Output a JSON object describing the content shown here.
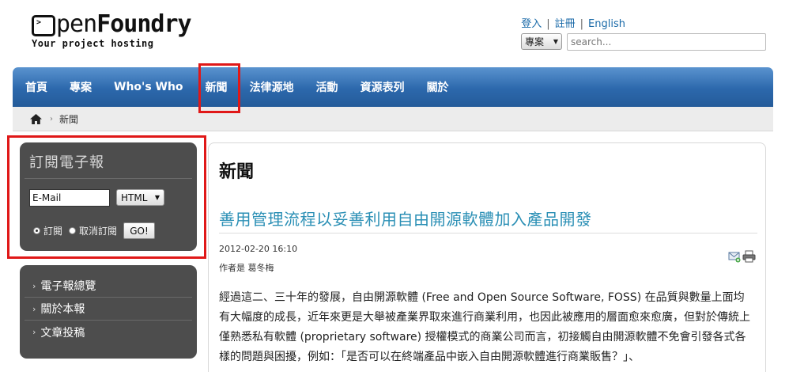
{
  "logo": {
    "prompt": ">",
    "open": "pen",
    "foundry": "Foundry",
    "tagline": "Your project hosting"
  },
  "toplinks": {
    "login": "登入",
    "register": "註冊",
    "english": "English",
    "sep": "|"
  },
  "search": {
    "scope": "專案",
    "placeholder": "search..."
  },
  "nav": [
    "首頁",
    "專案",
    "Who's Who",
    "新聞",
    "法律源地",
    "活動",
    "資源表列",
    "關於"
  ],
  "breadcrumb": {
    "current": "新聞"
  },
  "subscribe": {
    "title": "訂閱電子報",
    "email_value": "E-Mail",
    "format": "HTML",
    "opt_subscribe": "訂閱",
    "opt_unsubscribe": "取消訂閱",
    "go": "GO!"
  },
  "sidelinks": [
    "電子報總覽",
    "關於本報",
    "文章投稿"
  ],
  "main": {
    "page_title": "新聞",
    "article_title": "善用管理流程以妥善利用自由開源軟體加入產品開發",
    "date": "2012-02-20 16:10",
    "author": "作者是 葛冬梅",
    "body": "經過這二、三十年的發展，自由開源軟體 (Free and Open Source Software, FOSS) 在品質與數量上面均有大幅度的成長，近年來更是大舉被產業界取來進行商業利用，也因此被應用的層面愈來愈廣，但對於傳統上僅熟悉私有軟體 (proprietary software) 授權模式的商業公司而言，初接觸自由開源軟體不免會引發各式各樣的問題與困擾，例如：「是否可以在終端產品中嵌入自由開源軟體進行商業販售？」、"
  },
  "colors": {
    "nav": "#2c68ac",
    "link": "#1a6aa8",
    "article_title": "#2a8fb5",
    "panel": "#4d4d4d",
    "highlight": "#e01818"
  }
}
